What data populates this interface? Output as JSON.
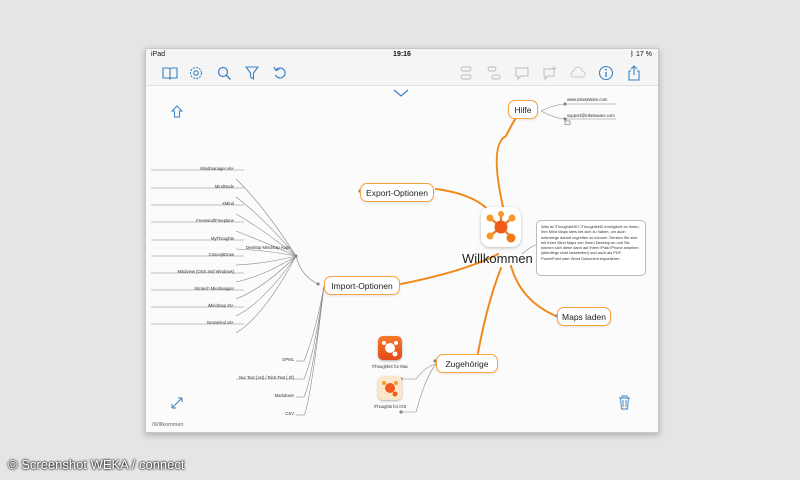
{
  "status_bar": {
    "device": "iPad",
    "time": "19:16",
    "battery": "ᛒ 17 %"
  },
  "toolbar": {
    "left_icons": [
      "book-icon",
      "gear-icon",
      "search-icon",
      "filter-icon",
      "undo-icon"
    ],
    "right_icons": [
      "node-group-icon",
      "node-cluster-icon",
      "comment-icon",
      "comment-add-icon",
      "cloud-icon",
      "info-icon",
      "share-icon"
    ]
  },
  "mindmap": {
    "center": {
      "title": "Willkommen"
    },
    "nodes": {
      "hilfe": "Hilfe",
      "export": "Export-Optionen",
      "import": "Import-Optionen",
      "zugehoerige": "Zugehörige",
      "maps": "Maps laden"
    },
    "hilfe_links": [
      "www.toketaWare.com",
      "support@toketaware.com"
    ],
    "note_text": "Was ist iThoughtsHD? iThoughtsHD ermöglicht es Ihnen, Ihre Mind Maps stets bei sich zu haben, um auch unterwegs darauf zugreifen zu können. Denken Sie sich mit Ihren Mind Maps von Ihrem Desktop an und Sie können sich diese dann auf Ihrem iPad/ iPhone ansehen (allerdings nicht bearbeiten) und auch als PDF, PowerPoint oder Word Dokument exportieren.",
    "desktop_group": "Desktop Mindmap Apps",
    "desktop_apps": [
      "Mindmanager v6+",
      "MindNode",
      "XMind",
      "Freemind/Freeplane",
      "MyThoughts",
      "ConceptDraw",
      "Mindview (OSX and Windows)",
      "Simtech Mindmapper",
      "iMindmap v5+",
      "Novamind v5+"
    ],
    "formats": [
      "OPML",
      "Nur Text (.txt) / Rich-Text (.rtf)",
      "Markdown",
      "CSV"
    ],
    "related_apps": [
      "iThoughtsX for Mac",
      "iThoughts for iOS"
    ]
  },
  "breadcrumb": "/Willkommen",
  "watermark": "© Screenshot WEKA / connect",
  "colors": {
    "accent": "#f5a340",
    "line": "#f08a1c",
    "icon_blue": "#3b82c4"
  }
}
